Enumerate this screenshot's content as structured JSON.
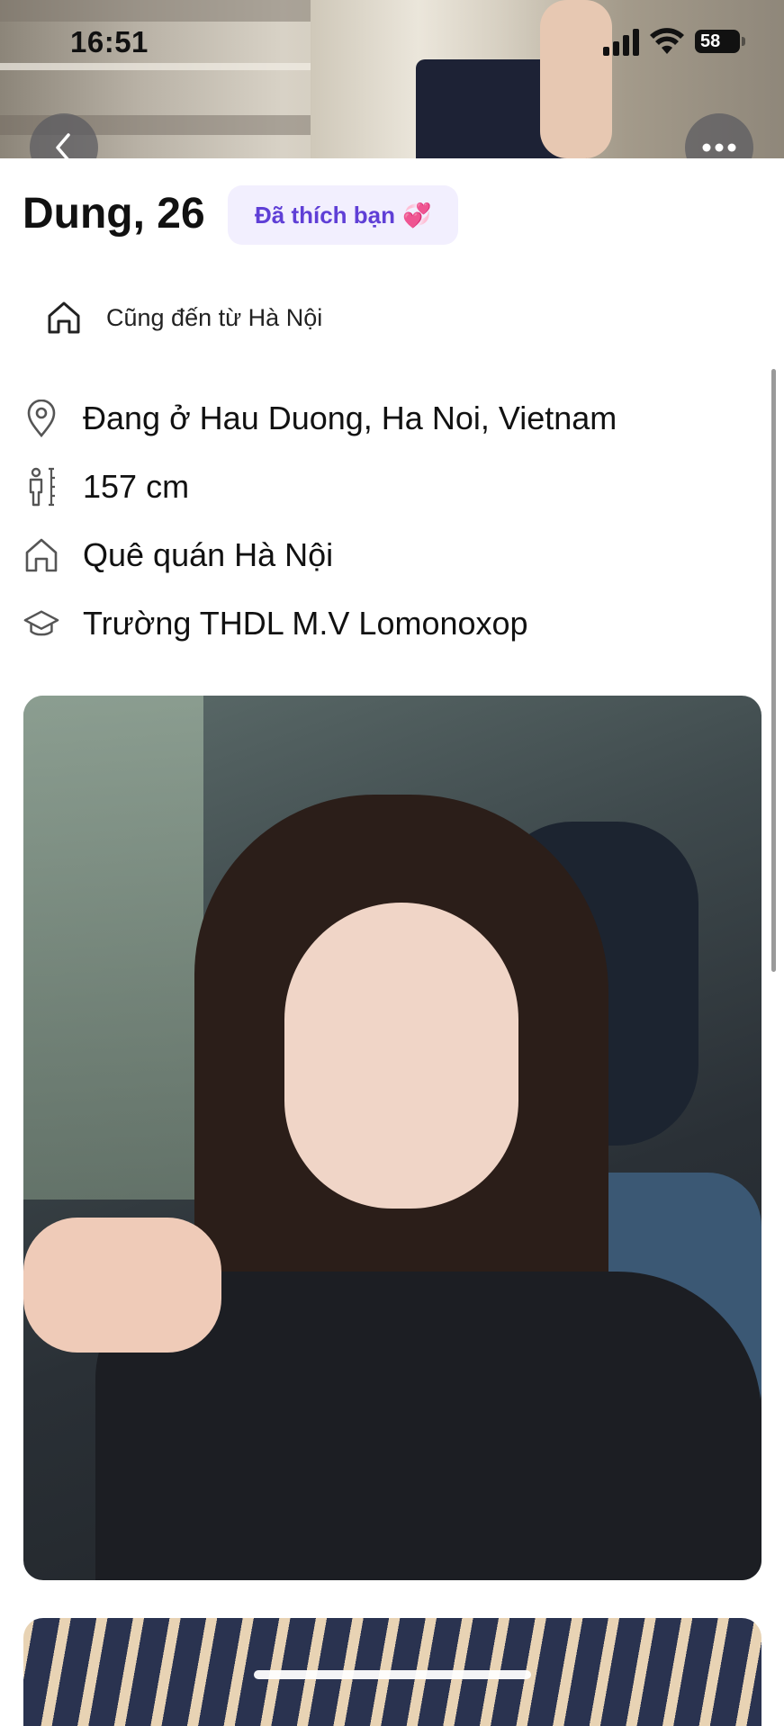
{
  "status_bar": {
    "time": "16:51",
    "battery": "58"
  },
  "profile": {
    "name_age": "Dung, 26",
    "liked_badge": "Đã thích bạn",
    "liked_badge_emoji": "💞",
    "from_same_city": "Cũng đến từ Hà Nội",
    "info": [
      {
        "icon": "location-pin-icon",
        "label": "Đang ở Hau Duong, Ha Noi, Vietnam"
      },
      {
        "icon": "height-icon",
        "label": "157 cm"
      },
      {
        "icon": "home-icon",
        "label": "Quê quán Hà Nội"
      },
      {
        "icon": "graduation-cap-icon",
        "label": "Trường THDL M.V Lomonoxop"
      }
    ]
  },
  "colors": {
    "badge_bg": "#f2effe",
    "badge_text": "#5f3fd6",
    "overlay_button": "#5a5a5f"
  }
}
